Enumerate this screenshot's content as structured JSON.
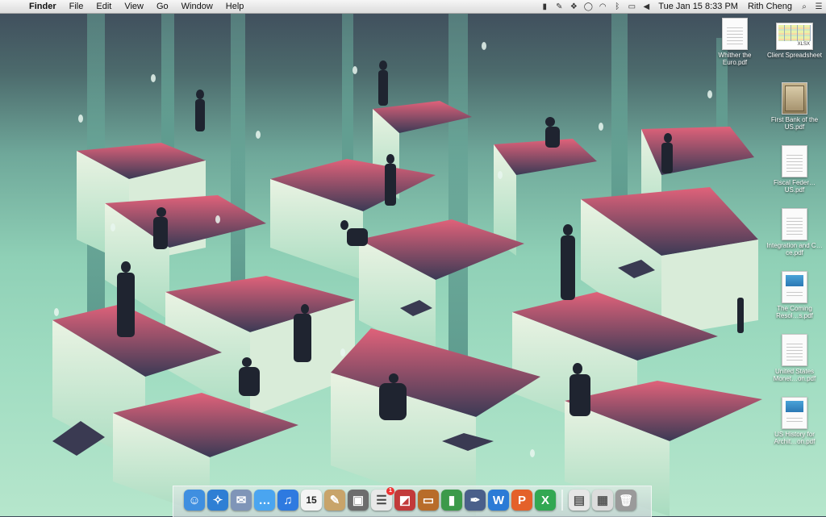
{
  "menubar": {
    "apple_glyph": "",
    "app_name": "Finder",
    "menus": [
      "File",
      "Edit",
      "View",
      "Go",
      "Window",
      "Help"
    ],
    "clock": "Tue Jan 15  8:33 PM",
    "user": "Rith Cheng",
    "status_icons": [
      "bookmark-icon",
      "script-icon",
      "dropbox-icon",
      "chat-icon",
      "wifi-icon",
      "bluetooth-icon",
      "battery-icon",
      "volume-icon"
    ]
  },
  "desktop_icons": [
    {
      "label": "Whither the Euro.pdf",
      "type": "pdf"
    },
    {
      "label": "Client Spreadsheet",
      "type": "xlsx",
      "tag": "XLSX"
    },
    {
      "label": "First Bank of the US.pdf",
      "type": "photo"
    },
    {
      "label": "Fiscal Feder…US.pdf",
      "type": "pdf"
    },
    {
      "label": "Integration and C…ce.pdf",
      "type": "pdf"
    },
    {
      "label": "The Coming Resol…s.pdf",
      "type": "colored"
    },
    {
      "label": "United States Monet…on.pdf",
      "type": "pdf"
    },
    {
      "label": "US History for Archit…on.pdf",
      "type": "colored"
    }
  ],
  "dock": {
    "items": [
      {
        "name": "finder",
        "glyph": "☺",
        "color": "#3f8fe0"
      },
      {
        "name": "safari",
        "glyph": "✧",
        "color": "#2f7fd4"
      },
      {
        "name": "mail",
        "glyph": "✉",
        "color": "#7f95b8"
      },
      {
        "name": "messages",
        "glyph": "…",
        "color": "#4aa5f0"
      },
      {
        "name": "itunes",
        "glyph": "♫",
        "color": "#2e7ae0"
      },
      {
        "name": "calendar",
        "glyph": "15",
        "color": "#f4f4f4"
      },
      {
        "name": "notes",
        "glyph": "✎",
        "color": "#c8a46a"
      },
      {
        "name": "iphoto",
        "glyph": "▣",
        "color": "#6d6d6d"
      },
      {
        "name": "reminders",
        "glyph": "☰",
        "color": "#e8e8e8",
        "badge": "1"
      },
      {
        "name": "photo-booth",
        "glyph": "◩",
        "color": "#c23a3a"
      },
      {
        "name": "keynote",
        "glyph": "▭",
        "color": "#b86c2a"
      },
      {
        "name": "numbers",
        "glyph": "▮",
        "color": "#3c9a4a"
      },
      {
        "name": "quill",
        "glyph": "✒",
        "color": "#4a5f8a"
      },
      {
        "name": "word",
        "glyph": "W",
        "color": "#2b7bd6"
      },
      {
        "name": "powerpoint",
        "glyph": "P",
        "color": "#e4612a"
      },
      {
        "name": "excel",
        "glyph": "X",
        "color": "#32a852"
      }
    ],
    "right_items": [
      {
        "name": "preview-doc",
        "glyph": "▤",
        "color": "#e6e6e6"
      },
      {
        "name": "downloads-stack",
        "glyph": "▦",
        "color": "#dcdcdc"
      },
      {
        "name": "trash",
        "glyph": "🗑",
        "color": "#9a9a9a"
      }
    ]
  }
}
